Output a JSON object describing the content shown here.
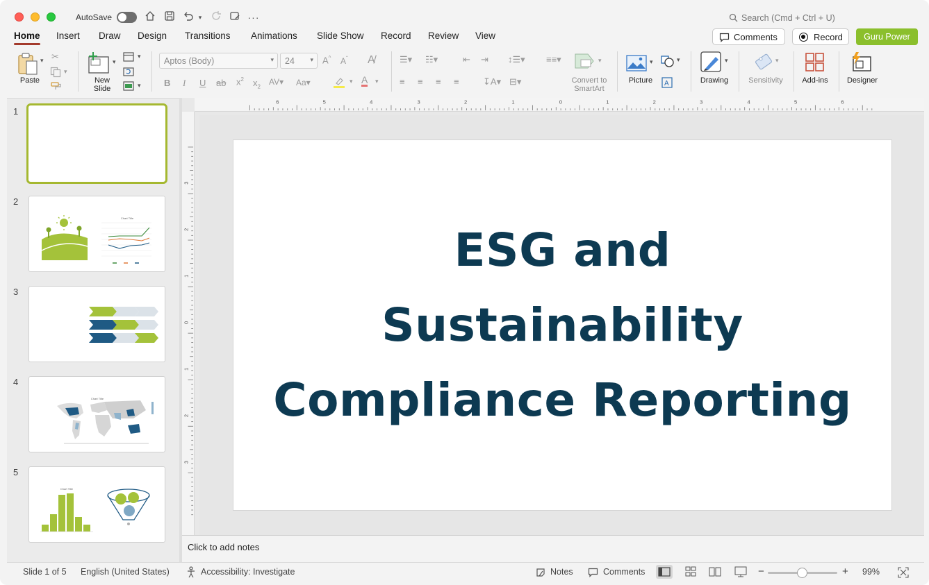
{
  "titlebar": {
    "autosave_label": "AutoSave",
    "search_placeholder": "Search (Cmd + Ctrl + U)"
  },
  "tabs": [
    {
      "label": "Home",
      "active": true
    },
    {
      "label": "Insert"
    },
    {
      "label": "Draw"
    },
    {
      "label": "Design"
    },
    {
      "label": "Transitions"
    },
    {
      "label": "Animations"
    },
    {
      "label": "Slide Show"
    },
    {
      "label": "Record"
    },
    {
      "label": "Review"
    },
    {
      "label": "View"
    }
  ],
  "header_buttons": {
    "comments": "Comments",
    "record": "Record",
    "guru": "Guru Power"
  },
  "ribbon": {
    "paste": "Paste",
    "new_slide_line1": "New",
    "new_slide_line2": "Slide",
    "font_name": "Aptos (Body)",
    "font_size": "24",
    "convert_line1": "Convert to",
    "convert_line2": "SmartArt",
    "picture": "Picture",
    "drawing": "Drawing",
    "sensitivity": "Sensitivity",
    "addins": "Add-ins",
    "designer": "Designer"
  },
  "thumbnails": [
    {
      "number": "1",
      "selected": true
    },
    {
      "number": "2"
    },
    {
      "number": "3"
    },
    {
      "number": "4"
    },
    {
      "number": "5"
    }
  ],
  "thumbnail_text": {
    "chart_title": "Chart Title"
  },
  "slide": {
    "title_lines": [
      "ESG and",
      "Sustainability",
      "Compliance Reporting"
    ],
    "title_color": "#0d3a52"
  },
  "notes": {
    "placeholder": "Click to add notes"
  },
  "status": {
    "slide_count": "Slide 1 of 5",
    "language": "English (United States)",
    "accessibility": "Accessibility: Investigate",
    "notes": "Notes",
    "comments": "Comments",
    "zoom": "99%"
  },
  "colors": {
    "accent_red": "#a33a2c",
    "green": "#8bbf2c",
    "navy": "#0d3a52"
  }
}
